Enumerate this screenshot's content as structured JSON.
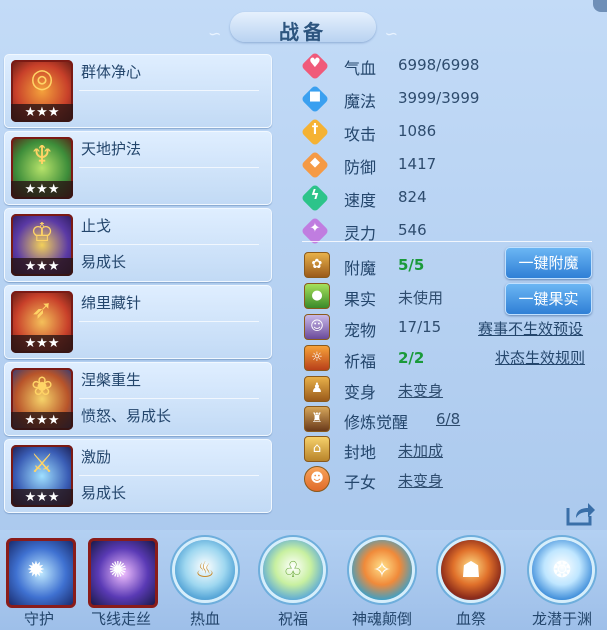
{
  "window": {
    "title": "战备"
  },
  "skills": [
    {
      "name": "群体净心",
      "sub": "",
      "stars": "★★★",
      "icon": "ring-icon",
      "color": "#c8402a"
    },
    {
      "name": "天地护法",
      "sub": "",
      "stars": "★★★",
      "icon": "dragon-icon",
      "color": "#3d8d3a"
    },
    {
      "name": "止戈",
      "sub": "易成长",
      "stars": "★★★",
      "icon": "warrior-icon",
      "color": "#5b3aa5"
    },
    {
      "name": "绵里藏针",
      "sub": "",
      "stars": "★★★",
      "icon": "needle-icon",
      "color": "#c8402a"
    },
    {
      "name": "涅槃重生",
      "sub": "愤怒、易成长",
      "stars": "★★★",
      "icon": "phoenix-icon",
      "color": "#b8542a"
    },
    {
      "name": "激励",
      "sub": "易成长",
      "stars": "★★★",
      "icon": "inspire-icon",
      "color": "#3a5db5"
    }
  ],
  "stats": [
    {
      "label": "气血",
      "value": "6998/6998",
      "icon": "heart-icon",
      "color": "#f05a7a",
      "glyph": "♥"
    },
    {
      "label": "魔法",
      "value": "3999/3999",
      "icon": "mana-icon",
      "color": "#3aa0f0",
      "glyph": "■"
    },
    {
      "label": "攻击",
      "value": "1086",
      "icon": "sword-icon",
      "color": "#f5b233",
      "glyph": "†"
    },
    {
      "label": "防御",
      "value": "1417",
      "icon": "shield-icon",
      "color": "#f59a45",
      "glyph": "◆"
    },
    {
      "label": "速度",
      "value": "824",
      "icon": "speed-icon",
      "color": "#2cc48a",
      "glyph": "ϟ"
    },
    {
      "label": "灵力",
      "value": "546",
      "icon": "spirit-icon",
      "color": "#c07de0",
      "glyph": "✦"
    }
  ],
  "props": [
    {
      "label": "附魔",
      "value": "5/5",
      "icon": "enchant-icon",
      "glyph": "✿"
    },
    {
      "label": "果实",
      "value": "未使用",
      "icon": "fruit-icon",
      "glyph": "●"
    },
    {
      "label": "宠物",
      "value": "17/15",
      "icon": "pet-icon",
      "glyph": "☺"
    },
    {
      "label": "祈福",
      "value": "2/2",
      "icon": "pray-icon",
      "glyph": "☼"
    },
    {
      "label": "变身",
      "value": "未变身",
      "icon": "transform-icon",
      "glyph": "♟"
    },
    {
      "label": "修炼觉醒",
      "value": "6/8",
      "icon": "cultivate-icon",
      "glyph": "♜"
    },
    {
      "label": "封地",
      "value": "未加成",
      "icon": "fief-icon",
      "glyph": "⌂"
    },
    {
      "label": "子女",
      "value": "未变身",
      "icon": "child-icon",
      "glyph": "☻"
    }
  ],
  "actions": {
    "enchant_button": "一键附魔",
    "fruit_button": "一键果实",
    "event_link": "赛事不生效预设",
    "rules_link": "状态生效规则"
  },
  "bottom_skills": [
    {
      "label": "守护",
      "icon": "guard-icon",
      "glyph": "✹"
    },
    {
      "label": "飞线走丝",
      "icon": "silk-icon",
      "glyph": "✺"
    },
    {
      "label": "热血",
      "icon": "hotblood-icon",
      "glyph": "♨"
    },
    {
      "label": "祝福",
      "icon": "bless-icon",
      "glyph": "♧"
    },
    {
      "label": "神魂颠倒",
      "icon": "charm-icon",
      "glyph": "✧"
    },
    {
      "label": "血祭",
      "icon": "bloodrite-icon",
      "glyph": "☗"
    },
    {
      "label": "龙潜于渊",
      "icon": "dragon-dive-icon",
      "glyph": "❂"
    }
  ]
}
